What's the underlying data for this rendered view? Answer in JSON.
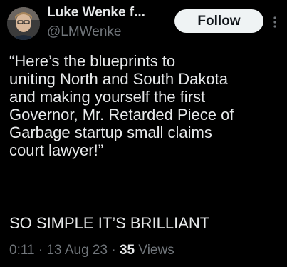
{
  "author": {
    "display_name": "Luke Wenke f...",
    "handle": "@LMWenke"
  },
  "follow_label": "Follow",
  "more_icon": "more-vertical-icon",
  "tweet": {
    "text": "“Here’s the blueprints to\nuniting North and South Dakota\nand making yourself the first\nGovernor, Mr. Retarded Piece of\nGarbage startup small claims\ncourt lawyer!”",
    "text_2": "SO SIMPLE IT’S BRILLIANT"
  },
  "meta": {
    "time": "0:11",
    "sep1": "·",
    "date": "13 Aug 23",
    "sep2": "·",
    "views_count": "35",
    "views_label": "Views"
  },
  "colors": {
    "background": "#000000",
    "text_primary": "#e7e9ea",
    "text_secondary": "#71767b",
    "follow_bg": "#eff3f4"
  }
}
